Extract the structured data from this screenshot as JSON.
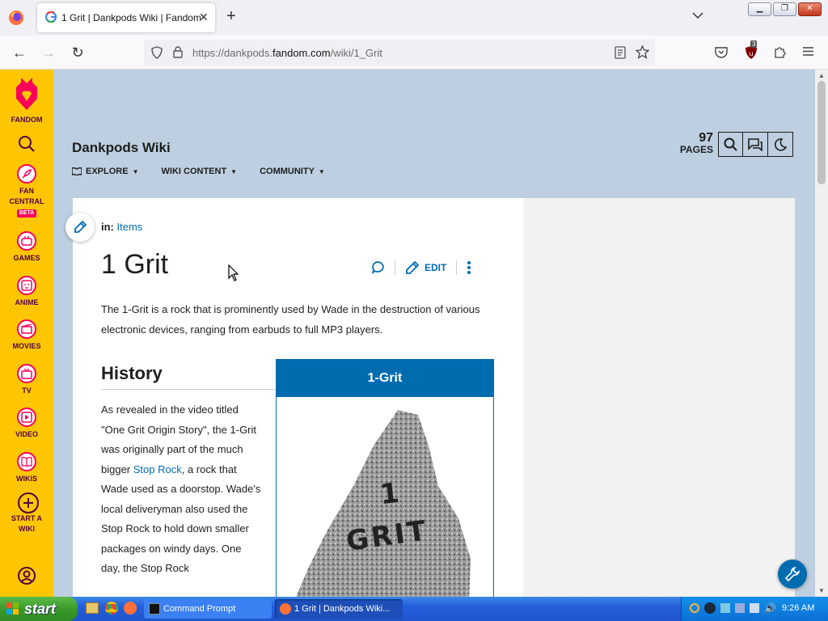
{
  "browser": {
    "tab_title": "1 Grit | Dankpods Wiki | Fandom",
    "url_prefix": "https://dankpods.",
    "url_domain": "fandom.com",
    "url_path": "/wiki/1_Grit",
    "extension_badge": "3"
  },
  "rail": {
    "brand": "FANDOM",
    "items": [
      {
        "label1": "FAN",
        "label2": "CENTRAL",
        "badge": "BETA"
      },
      {
        "label1": "GAMES"
      },
      {
        "label1": "ANIME"
      },
      {
        "label1": "MOVIES"
      },
      {
        "label1": "TV"
      },
      {
        "label1": "VIDEO"
      },
      {
        "label1": "WIKIS"
      },
      {
        "label1": "START A",
        "label2": "WIKI"
      }
    ]
  },
  "wiki": {
    "name": "Dankpods Wiki",
    "nav": [
      "EXPLORE",
      "WIKI CONTENT",
      "COMMUNITY"
    ],
    "pages_count": "97",
    "pages_label": "PAGES"
  },
  "article": {
    "category_prefix": "in:",
    "category": "Items",
    "title": "1 Grit",
    "edit_label": "EDIT",
    "intro": "The 1-Grit is a rock that is prominently used by Wade in the destruction of various electronic devices, ranging from earbuds to full MP3 players.",
    "history_heading": "History",
    "history_part1": "As revealed in the video titled \"One Grit Origin Story\", the 1-Grit was originally part of the much bigger ",
    "history_link": "Stop Rock",
    "history_part2": ", a rock that Wade used as a doorstop. Wade's local deliveryman also used the Stop Rock to hold down smaller packages on windy days. One day, the Stop Rock",
    "infobox_title": "1-Grit",
    "rock_text_1": "1",
    "rock_text_2": "GRIT"
  },
  "taskbar": {
    "start": "start",
    "tasks": [
      "Command Prompt",
      "1 Grit | Dankpods Wiki..."
    ],
    "time": "9:26 AM"
  },
  "colors": {
    "fandom_yellow": "#fec600",
    "fandom_pink": "#fa005a",
    "link_blue": "#006cb0",
    "page_bg": "#bdcfe0"
  }
}
